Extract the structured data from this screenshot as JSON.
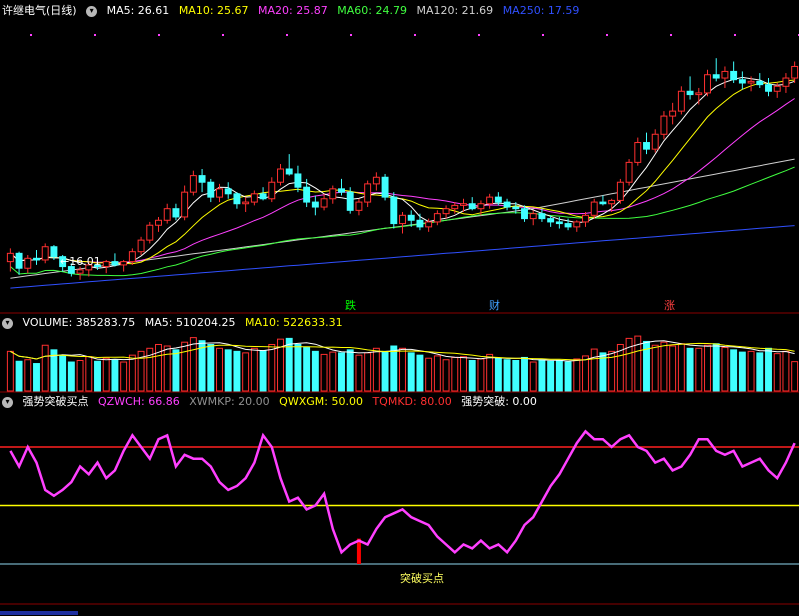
{
  "window": {
    "title": "许继电气(日线)"
  },
  "price_panel": {
    "ma_labels": [
      {
        "text": "MA5: 26.61",
        "color": "#ffffff"
      },
      {
        "text": "MA10: 25.67",
        "color": "#ffff00"
      },
      {
        "text": "MA20: 25.87",
        "color": "#ff40ff"
      },
      {
        "text": "MA60: 24.79",
        "color": "#40ff40"
      },
      {
        "text": "MA120: 21.69",
        "color": "#d0d0d0"
      },
      {
        "text": "MA250: 17.59",
        "color": "#3050ff"
      }
    ],
    "low_annotation": "←16.01",
    "tags": [
      {
        "text": "跌",
        "color": "#00ff00"
      },
      {
        "text": "财",
        "color": "#40a0ff"
      },
      {
        "text": "涨",
        "color": "#ff4040"
      }
    ]
  },
  "volume_panel": {
    "labels": [
      {
        "text": "VOLUME: 385283.75",
        "color": "#ffffff"
      },
      {
        "text": "MA5: 510204.25",
        "color": "#ffffff"
      },
      {
        "text": "MA10: 522633.31",
        "color": "#ffff00"
      }
    ]
  },
  "indicator_panel": {
    "labels": [
      {
        "text": "强势突破买点",
        "color": "#ffffff"
      },
      {
        "text": "QZWCH: 66.86",
        "color": "#ff40ff"
      },
      {
        "text": "XWMKP: 20.00",
        "color": "#909090"
      },
      {
        "text": "QWXGM: 50.00",
        "color": "#ffff00"
      },
      {
        "text": "TQMKD: 80.00",
        "color": "#ff3030"
      },
      {
        "text": "强势突破: 0.00",
        "color": "#ffffff"
      }
    ],
    "signal_label": "突破买点"
  },
  "chart_data": {
    "type": "candlestick",
    "candles": [
      [
        17.8,
        18.6,
        17.2,
        18.3
      ],
      [
        18.3,
        18.4,
        17.0,
        17.4
      ],
      [
        17.4,
        18.2,
        17.1,
        18.0
      ],
      [
        18.0,
        18.5,
        17.6,
        17.9
      ],
      [
        17.9,
        18.9,
        17.7,
        18.7
      ],
      [
        18.7,
        18.8,
        17.9,
        18.1
      ],
      [
        18.1,
        18.2,
        17.2,
        17.5
      ],
      [
        17.5,
        17.7,
        16.9,
        17.1
      ],
      [
        17.1,
        17.5,
        16.7,
        17.3
      ],
      [
        17.3,
        17.8,
        16.9,
        17.6
      ],
      [
        17.6,
        17.9,
        17.3,
        17.5
      ],
      [
        17.5,
        17.9,
        17.1,
        17.8
      ],
      [
        17.8,
        18.3,
        17.5,
        17.6
      ],
      [
        17.6,
        17.9,
        17.2,
        17.8
      ],
      [
        17.8,
        18.6,
        17.6,
        18.4
      ],
      [
        18.4,
        19.3,
        18.2,
        19.1
      ],
      [
        19.1,
        20.2,
        18.9,
        20.0
      ],
      [
        20.0,
        20.5,
        19.6,
        20.3
      ],
      [
        20.3,
        21.3,
        20.1,
        21.0
      ],
      [
        21.0,
        21.3,
        20.3,
        20.5
      ],
      [
        20.5,
        22.4,
        20.3,
        22.0
      ],
      [
        22.0,
        23.3,
        21.8,
        23.0
      ],
      [
        23.0,
        23.4,
        22.0,
        22.6
      ],
      [
        22.6,
        22.8,
        21.4,
        21.7
      ],
      [
        21.7,
        22.5,
        21.4,
        22.2
      ],
      [
        22.2,
        22.6,
        21.6,
        21.9
      ],
      [
        21.9,
        22.0,
        21.0,
        21.3
      ],
      [
        21.3,
        21.7,
        20.8,
        21.4
      ],
      [
        21.4,
        22.1,
        21.2,
        21.9
      ],
      [
        21.9,
        22.3,
        21.5,
        21.6
      ],
      [
        21.6,
        22.9,
        21.4,
        22.6
      ],
      [
        22.6,
        23.7,
        22.4,
        23.4
      ],
      [
        23.4,
        24.3,
        23.0,
        23.1
      ],
      [
        23.1,
        23.6,
        22.0,
        22.3
      ],
      [
        22.3,
        22.8,
        21.1,
        21.4
      ],
      [
        21.4,
        21.8,
        20.6,
        21.1
      ],
      [
        21.1,
        21.9,
        20.9,
        21.6
      ],
      [
        21.6,
        22.4,
        21.3,
        22.2
      ],
      [
        22.2,
        22.8,
        21.8,
        22.0
      ],
      [
        22.0,
        22.3,
        20.7,
        20.9
      ],
      [
        20.9,
        21.6,
        20.6,
        21.4
      ],
      [
        21.4,
        22.7,
        21.1,
        22.5
      ],
      [
        22.5,
        23.2,
        22.1,
        22.9
      ],
      [
        22.9,
        23.1,
        21.5,
        21.7
      ],
      [
        21.7,
        22.0,
        19.8,
        20.1
      ],
      [
        20.1,
        20.8,
        19.5,
        20.6
      ],
      [
        20.6,
        20.9,
        19.9,
        20.3
      ],
      [
        20.3,
        20.7,
        19.7,
        19.9
      ],
      [
        19.9,
        20.4,
        19.6,
        20.2
      ],
      [
        20.2,
        20.9,
        20.0,
        20.7
      ],
      [
        20.7,
        21.2,
        20.4,
        21.0
      ],
      [
        21.0,
        21.4,
        20.7,
        21.2
      ],
      [
        21.2,
        21.6,
        20.8,
        21.3
      ],
      [
        21.3,
        21.7,
        20.9,
        21.0
      ],
      [
        21.0,
        21.5,
        20.6,
        21.3
      ],
      [
        21.3,
        21.9,
        21.0,
        21.7
      ],
      [
        21.7,
        22.0,
        21.2,
        21.4
      ],
      [
        21.4,
        21.6,
        20.9,
        21.1
      ],
      [
        21.1,
        21.4,
        20.7,
        21.0
      ],
      [
        21.0,
        21.2,
        20.2,
        20.4
      ],
      [
        20.4,
        20.9,
        20.0,
        20.7
      ],
      [
        20.7,
        21.0,
        20.2,
        20.4
      ],
      [
        20.4,
        20.6,
        19.9,
        20.2
      ],
      [
        20.2,
        20.5,
        19.8,
        20.1
      ],
      [
        20.1,
        20.4,
        19.7,
        19.9
      ],
      [
        19.9,
        20.3,
        19.6,
        20.2
      ],
      [
        20.2,
        20.8,
        19.9,
        20.6
      ],
      [
        20.6,
        21.6,
        20.4,
        21.4
      ],
      [
        21.4,
        21.8,
        21.2,
        21.3
      ],
      [
        21.3,
        21.6,
        20.8,
        21.5
      ],
      [
        21.5,
        22.8,
        21.3,
        22.6
      ],
      [
        22.6,
        24.0,
        22.4,
        23.8
      ],
      [
        23.8,
        25.3,
        23.6,
        25.0
      ],
      [
        25.0,
        25.6,
        24.3,
        24.6
      ],
      [
        24.6,
        25.8,
        24.4,
        25.5
      ],
      [
        25.5,
        26.9,
        25.2,
        26.6
      ],
      [
        26.6,
        27.4,
        26.1,
        26.9
      ],
      [
        26.9,
        28.4,
        26.7,
        28.1
      ],
      [
        28.1,
        29.0,
        27.6,
        27.9
      ],
      [
        27.9,
        28.3,
        27.3,
        28.0
      ],
      [
        28.0,
        29.4,
        27.8,
        29.1
      ],
      [
        29.1,
        30.1,
        28.7,
        28.9
      ],
      [
        28.9,
        29.6,
        28.3,
        29.3
      ],
      [
        29.3,
        29.9,
        28.6,
        28.8
      ],
      [
        28.8,
        29.3,
        28.2,
        28.6
      ],
      [
        28.6,
        29.0,
        28.1,
        28.7
      ],
      [
        28.7,
        29.2,
        28.3,
        28.5
      ],
      [
        28.5,
        28.9,
        27.8,
        28.1
      ],
      [
        28.1,
        28.6,
        27.7,
        28.4
      ],
      [
        28.4,
        29.2,
        28.0,
        28.9
      ],
      [
        28.9,
        29.9,
        28.6,
        29.6
      ]
    ],
    "volume": [
      520,
      390,
      410,
      360,
      600,
      540,
      470,
      380,
      400,
      450,
      390,
      430,
      410,
      380,
      470,
      520,
      560,
      610,
      590,
      540,
      640,
      700,
      660,
      610,
      560,
      540,
      520,
      500,
      560,
      530,
      610,
      680,
      690,
      610,
      570,
      520,
      480,
      510,
      500,
      540,
      470,
      500,
      560,
      520,
      590,
      560,
      500,
      470,
      430,
      460,
      410,
      440,
      450,
      400,
      420,
      480,
      430,
      410,
      400,
      440,
      380,
      410,
      390,
      400,
      380,
      420,
      460,
      550,
      500,
      520,
      610,
      690,
      720,
      650,
      600,
      640,
      590,
      620,
      560,
      560,
      600,
      620,
      570,
      540,
      510,
      520,
      500,
      560,
      490,
      520,
      385
    ],
    "qzwch": [
      78,
      70,
      80,
      72,
      58,
      55,
      58,
      62,
      70,
      66,
      72,
      64,
      68,
      78,
      86,
      80,
      74,
      84,
      86,
      70,
      76,
      74,
      74,
      70,
      62,
      58,
      60,
      64,
      72,
      86,
      80,
      64,
      52,
      54,
      48,
      50,
      56,
      38,
      26,
      30,
      32,
      30,
      38,
      44,
      46,
      48,
      44,
      42,
      40,
      34,
      30,
      26,
      30,
      28,
      32,
      28,
      30,
      26,
      32,
      40,
      44,
      52,
      60,
      66,
      74,
      82,
      88,
      84,
      84,
      80,
      84,
      86,
      80,
      78,
      72,
      74,
      68,
      70,
      76,
      84,
      84,
      78,
      76,
      78,
      70,
      72,
      74,
      68,
      64,
      72,
      82
    ],
    "signal_index": 40,
    "price_range": [
      15.6,
      31.2
    ],
    "volume_range": [
      0,
      800
    ],
    "indicator_range": [
      0,
      100
    ],
    "lines": {
      "xwmkp": 20,
      "qwxgm": 50,
      "tqmkd": 80
    }
  },
  "colors": {
    "up": "#ff3030",
    "down": "#40ffff",
    "bg": "#000000",
    "sep": "#8a0000"
  }
}
